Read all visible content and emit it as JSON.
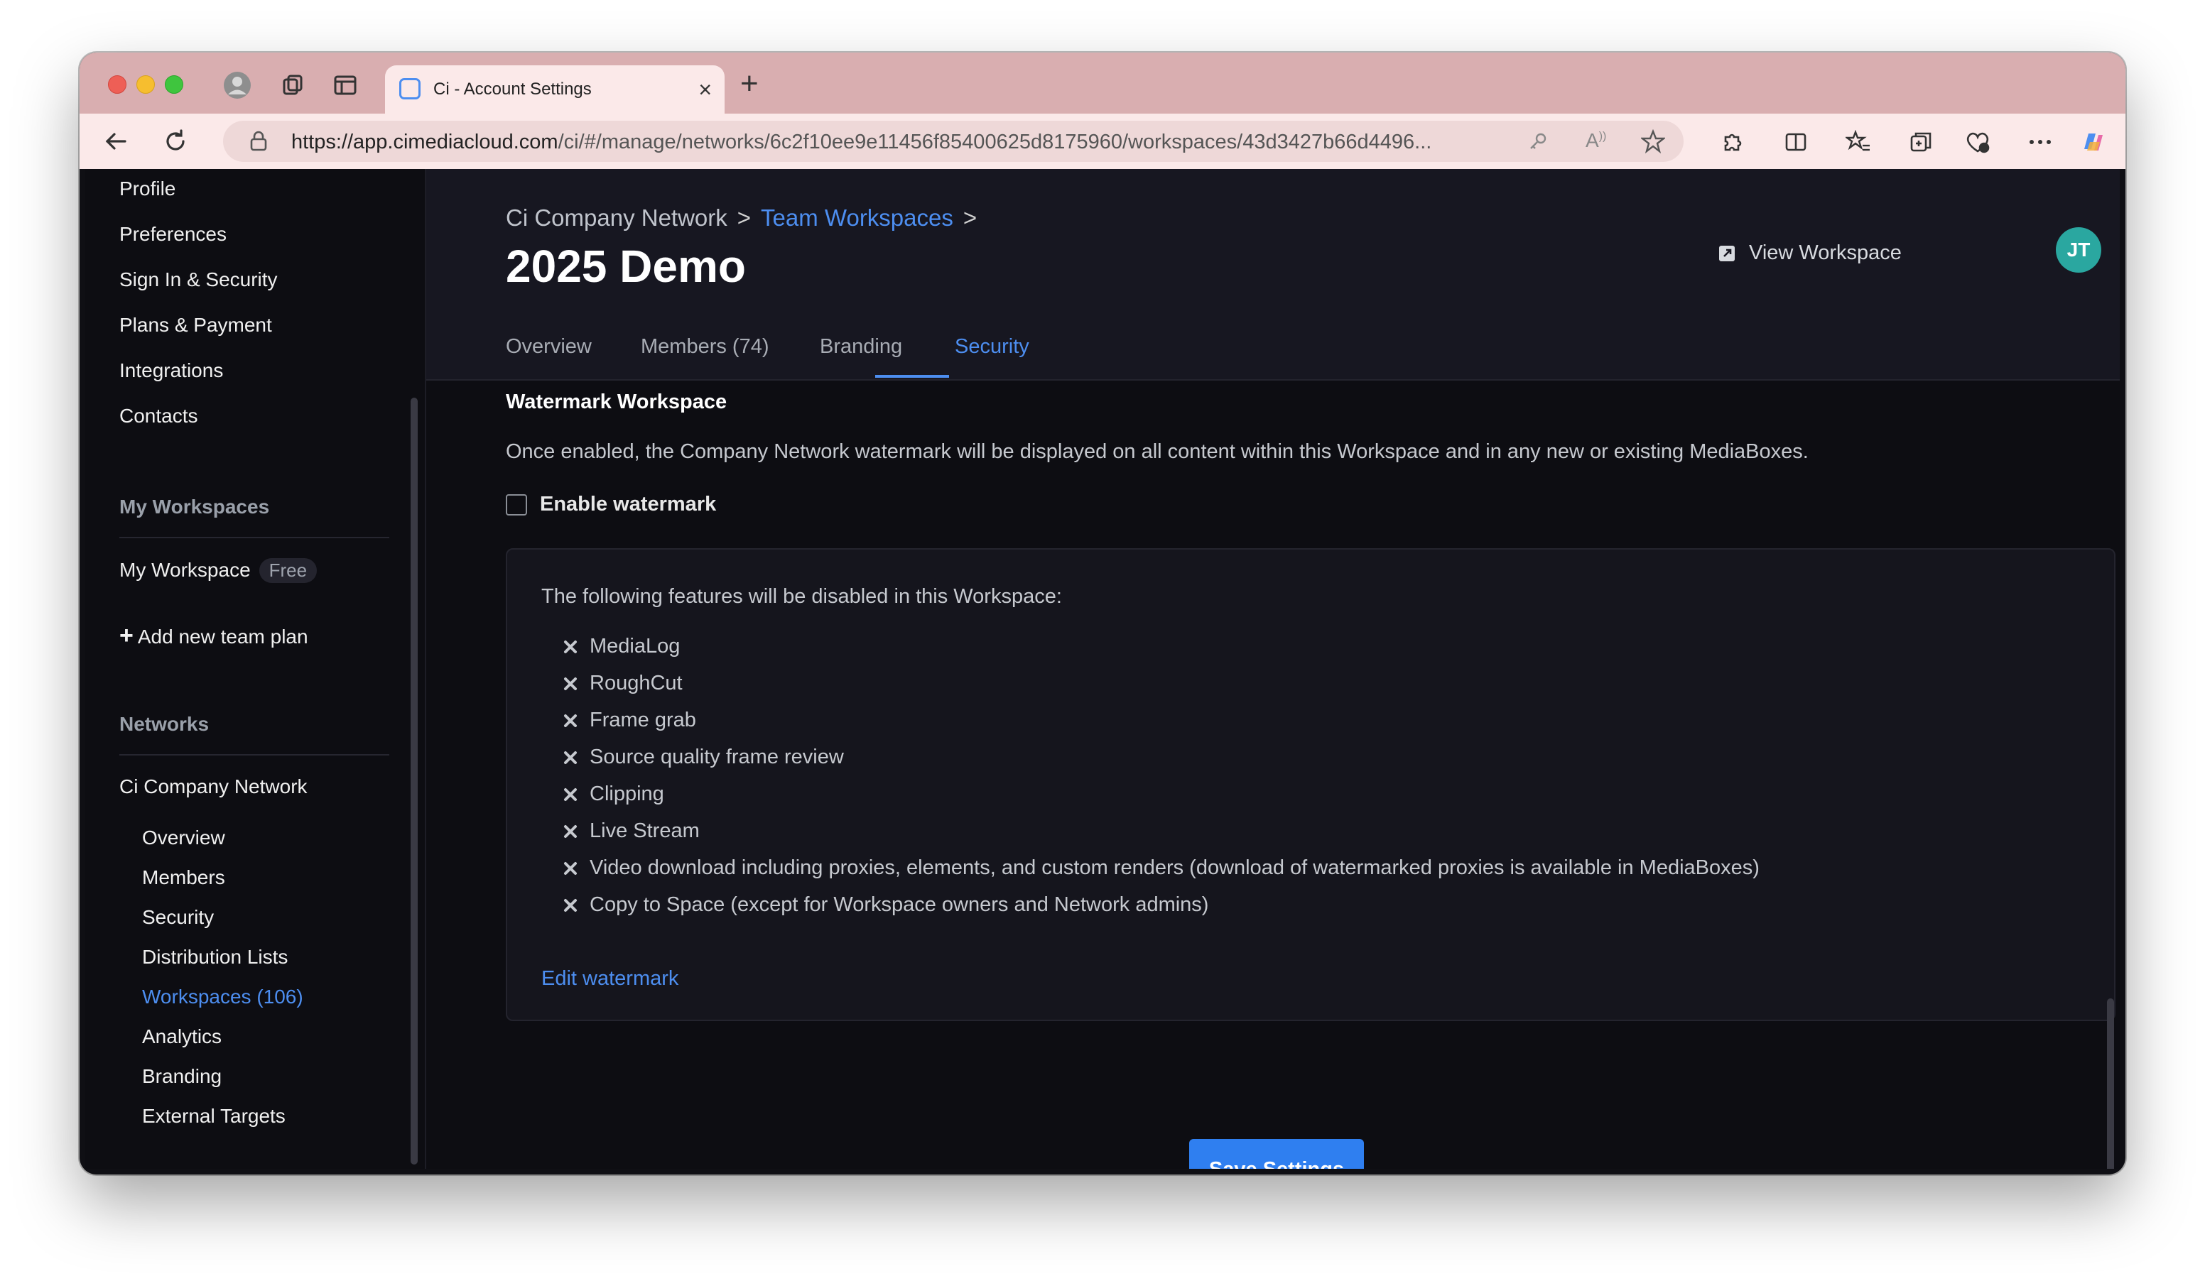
{
  "browser": {
    "tab_title": "Ci - Account Settings",
    "url_host": "https://app.cimediacloud.com",
    "url_path": "/ci/#/manage/networks/6c2f10ee9e11456f85400625d8175960/workspaces/43d3427b66d4496..."
  },
  "sidebar": {
    "account_items": [
      "Profile",
      "Preferences",
      "Sign In & Security",
      "Plans & Payment",
      "Integrations",
      "Contacts"
    ],
    "my_workspaces_heading": "My Workspaces",
    "my_workspace": {
      "label": "My Workspace",
      "badge": "Free"
    },
    "add_plan": "Add new team plan",
    "networks_heading": "Networks",
    "network_name": "Ci Company Network",
    "network_items": [
      "Overview",
      "Members",
      "Security",
      "Distribution Lists",
      "Workspaces (106)",
      "Analytics",
      "Branding",
      "External Targets"
    ]
  },
  "header": {
    "breadcrumb": {
      "root": "Ci Company Network",
      "sep": ">",
      "link": "Team Workspaces",
      "sep2": ">"
    },
    "title": "2025 Demo",
    "view_workspace": "View Workspace",
    "avatar_initials": "JT",
    "help": "?",
    "tabs": [
      "Overview",
      "Members (74)",
      "Branding",
      "Security"
    ],
    "active_tab": "Security"
  },
  "watermark": {
    "title": "Watermark Workspace",
    "description": "Once enabled, the Company Network watermark will be displayed on all content within this Workspace and in any new or existing MediaBoxes.",
    "checkbox_label": "Enable watermark",
    "panel_intro": "The following features will be disabled in this Workspace:",
    "disabled_features": [
      "MediaLog",
      "RoughCut",
      "Frame grab",
      "Source quality frame review",
      "Clipping",
      "Live Stream",
      "Video download including proxies, elements, and custom renders (download of watermarked proxies is available in MediaBoxes)",
      "Copy to Space (except for Workspace owners and Network admins)"
    ],
    "edit_link": "Edit watermark"
  },
  "save_button": "Save Settings",
  "colors": {
    "accent": "#4d8ef0",
    "avatar": "#2aa7a0",
    "button": "#2f7ff0"
  }
}
